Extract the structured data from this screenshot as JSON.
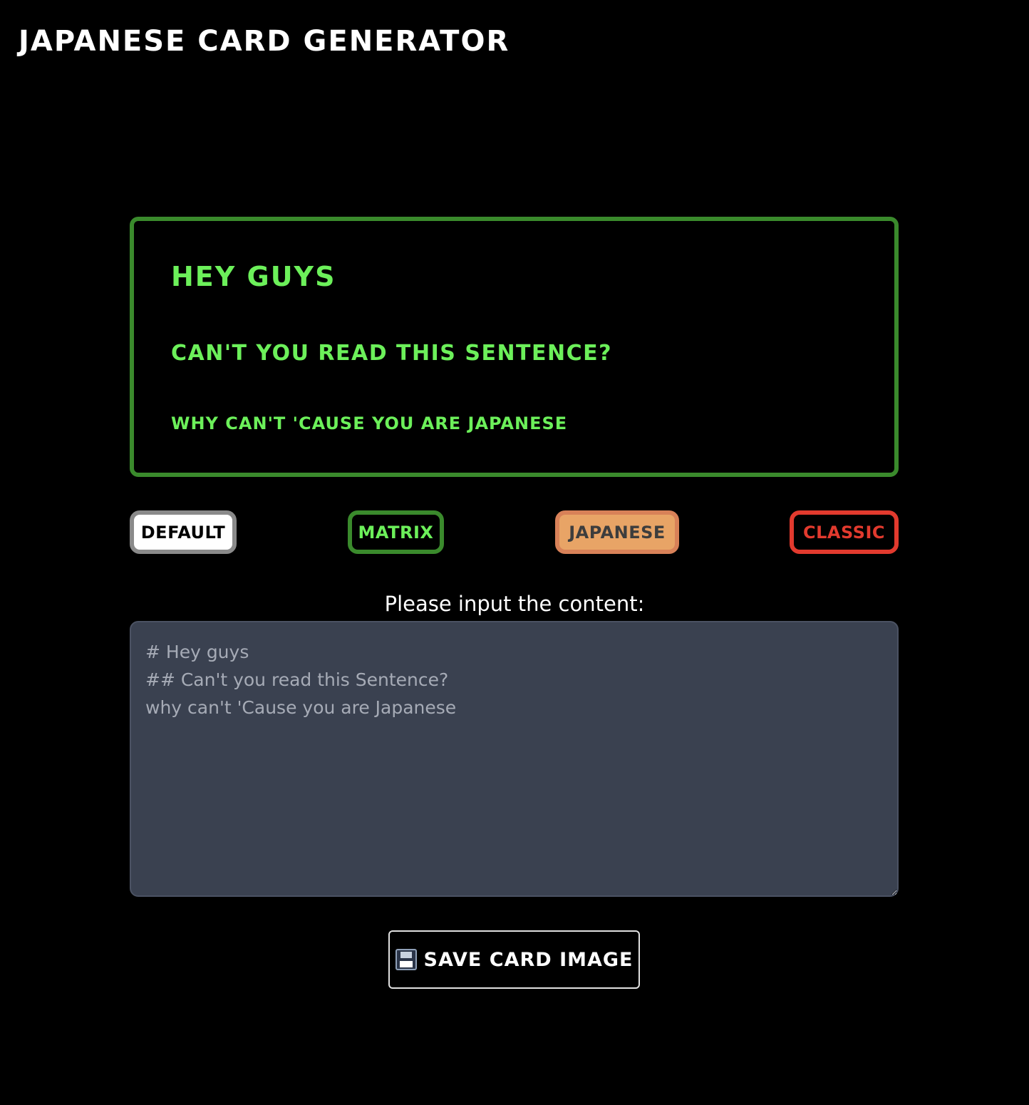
{
  "app": {
    "title": "Japanese Card Generator"
  },
  "card": {
    "heading1": "Hey guys",
    "heading2": "Can't you read this Sentence?",
    "paragraph": "why can't 'Cause you are Japanese",
    "colors": {
      "border": "#3a8a2c",
      "text": "#6cf05a",
      "background": "#000000"
    }
  },
  "themes": {
    "default_label": "Default",
    "matrix_label": "Matrix",
    "japanese_label": "Japanese",
    "classic_label": "Classic",
    "selected": "Matrix"
  },
  "editor": {
    "label": "Please input the content:",
    "value": "# Hey guys\n## Can't you read this Sentence?\nwhy can't 'Cause you are Japanese"
  },
  "actions": {
    "save_icon": "floppy-disk-icon",
    "save_label": "Save Card Image"
  }
}
